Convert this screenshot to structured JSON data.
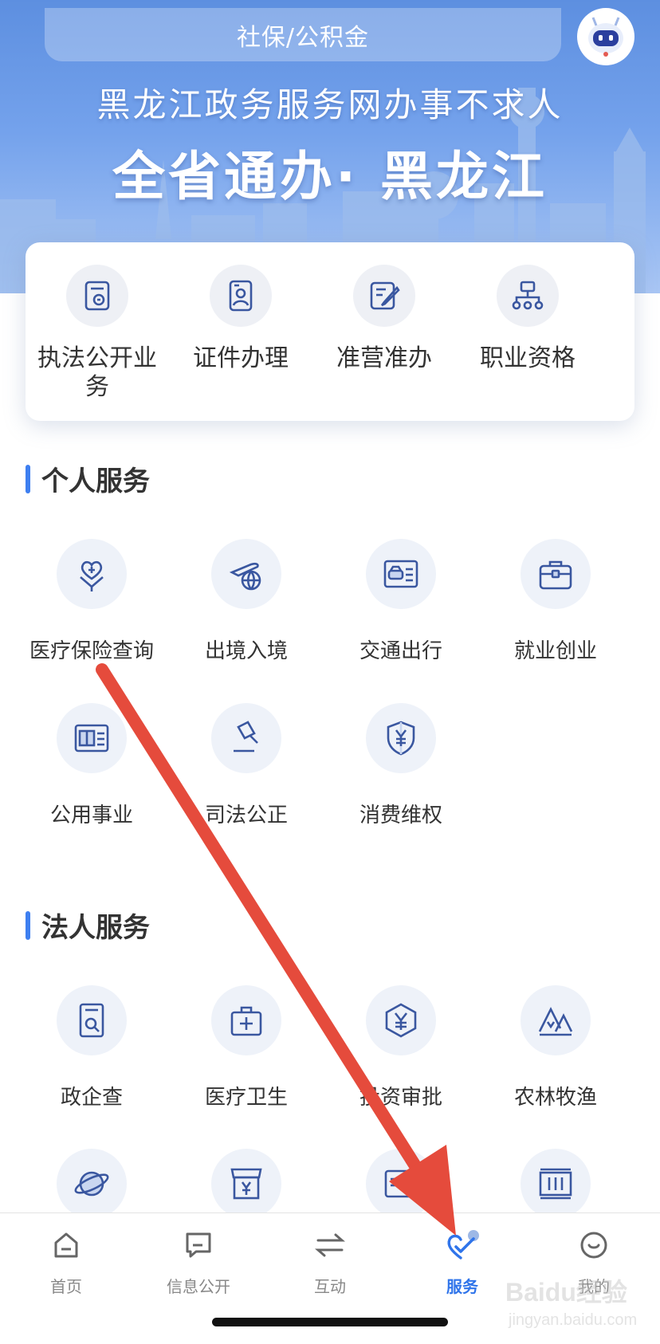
{
  "header": {
    "search_text": "社保/公积金",
    "slogan_line1": "黑龙江政务服务网办事不求人",
    "slogan_line2": "全省通办· 黑龙江"
  },
  "quick_services": [
    {
      "label": "执法公开业务",
      "icon": "document-badge-icon"
    },
    {
      "label": "证件办理",
      "icon": "id-card-icon"
    },
    {
      "label": "准营准办",
      "icon": "edit-document-icon"
    },
    {
      "label": "职业资格",
      "icon": "org-chart-icon"
    }
  ],
  "personal_services": {
    "title": "个人服务",
    "items": [
      {
        "label": "医疗保险查询",
        "icon": "heart-hands-icon"
      },
      {
        "label": "出境入境",
        "icon": "plane-globe-icon"
      },
      {
        "label": "交通出行",
        "icon": "car-card-icon"
      },
      {
        "label": "就业创业",
        "icon": "briefcase-icon"
      },
      {
        "label": "公用事业",
        "icon": "book-card-icon"
      },
      {
        "label": "司法公正",
        "icon": "gavel-icon"
      },
      {
        "label": "消费维权",
        "icon": "yuan-shield-icon"
      }
    ]
  },
  "legal_services": {
    "title": "法人服务",
    "items": [
      {
        "label": "政企查",
        "icon": "search-document-icon"
      },
      {
        "label": "医疗卫生",
        "icon": "medical-kit-icon"
      },
      {
        "label": "投资审批",
        "icon": "yuan-hexagon-icon"
      },
      {
        "label": "农林牧渔",
        "icon": "mountain-tree-icon"
      },
      {
        "label": "",
        "icon": "planet-icon"
      },
      {
        "label": "",
        "icon": "shop-yuan-icon"
      },
      {
        "label": "",
        "icon": "form-icon"
      },
      {
        "label": "",
        "icon": "container-icon"
      }
    ]
  },
  "bottom_nav": {
    "items": [
      {
        "label": "首页",
        "icon": "home-icon"
      },
      {
        "label": "信息公开",
        "icon": "message-icon"
      },
      {
        "label": "互动",
        "icon": "exchange-icon"
      },
      {
        "label": "服务",
        "icon": "heart-check-icon"
      },
      {
        "label": "我的",
        "icon": "smile-icon"
      }
    ],
    "active_label": "服务"
  },
  "colors": {
    "accent": "#2f74ea",
    "icon_blue": "#3a57a0",
    "annotation_arrow": "#e54b3c"
  },
  "watermark": {
    "line1": "Baidu经验",
    "line2": "jingyan.baidu.com"
  }
}
